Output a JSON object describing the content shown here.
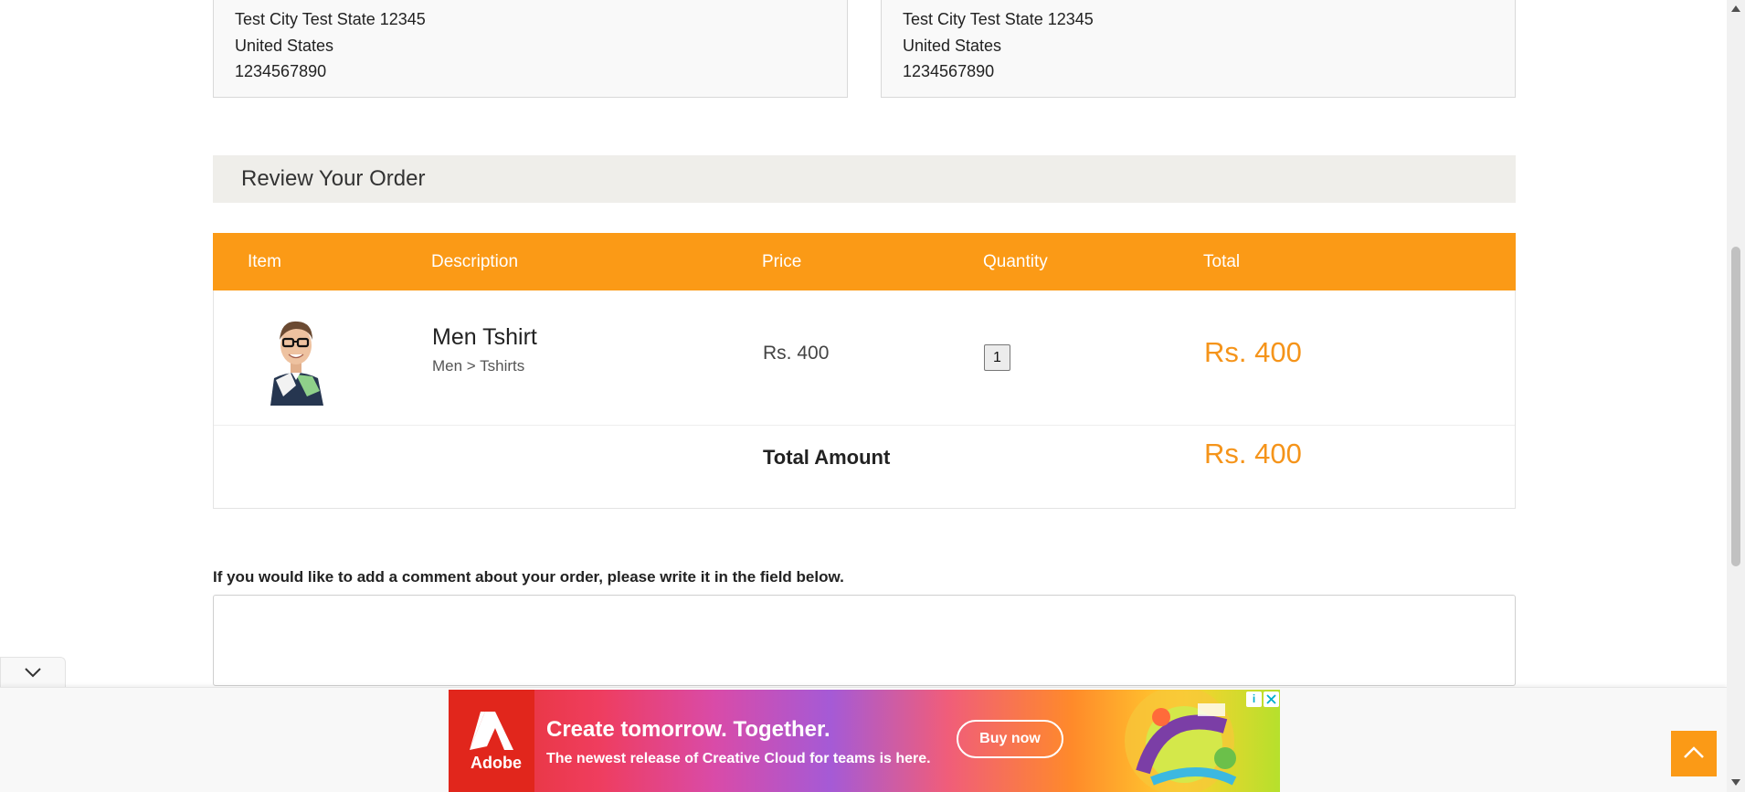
{
  "shipping_address": {
    "lines": [
      "Test City Test State 12345",
      "United States",
      "1234567890"
    ]
  },
  "billing_address": {
    "lines": [
      "Test City Test State 12345",
      "United States",
      "1234567890"
    ]
  },
  "review": {
    "title": "Review Your Order"
  },
  "order_table": {
    "headers": {
      "item": "Item",
      "description": "Description",
      "price": "Price",
      "quantity": "Quantity",
      "total": "Total"
    },
    "rows": [
      {
        "name": "Men Tshirt",
        "category": "Men > Tshirts",
        "price": "Rs. 400",
        "quantity": "1",
        "total": "Rs. 400"
      }
    ],
    "total_label": "Total Amount",
    "total_amount": "Rs. 400"
  },
  "comment": {
    "label": "If you would like to add a comment about your order, please write it in the field below.",
    "value": ""
  },
  "ad": {
    "brand": "Adobe",
    "headline": "Create tomorrow. Together.",
    "subline": "The newest release of Creative Cloud for teams is here.",
    "cta": "Buy now",
    "info_glyph": "i"
  },
  "colors": {
    "accent": "#fb9a16",
    "price_highlight": "#f5941a",
    "review_header_bg": "#efeeea"
  }
}
